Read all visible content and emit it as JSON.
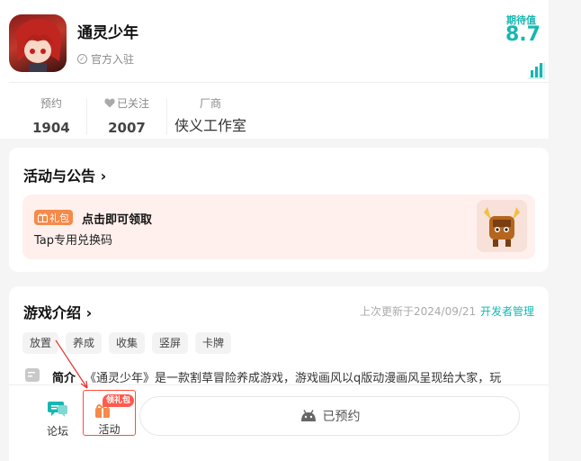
{
  "header": {
    "app_title": "通灵少年",
    "official_label": "官方入驻",
    "rating_label": "期待值",
    "rating_value": "8.7"
  },
  "stats": {
    "reservations_label": "预约",
    "reservations_value": "1904",
    "followed_label": "已关注",
    "followed_value": "2007",
    "developer_label": "厂商",
    "developer_name": "侠义工作室"
  },
  "activities": {
    "title": "活动与公告 ›",
    "gift_tag": "礼包",
    "gift_title": "点击即可领取",
    "gift_code": "Tap专用兑换码"
  },
  "intro": {
    "title": "游戏介绍 ›",
    "update_time": "上次更新于2024/09/21",
    "developer_manage": "开发者管理",
    "tags": [
      "放置",
      "养成",
      "收集",
      "竖屏",
      "卡牌"
    ],
    "summary_label": "简介",
    "summary_text": "《通灵少年》是一款割草冒险养成游戏，游戏画风以q版动漫画风呈现给大家，玩"
  },
  "bottom_bar": {
    "forum_label": "论坛",
    "activity_label": "活动",
    "gift_badge": "领礼包",
    "reserved_label": "已预约"
  },
  "colors": {
    "accent": "#17b7b0",
    "gift_orange": "#f58a4b",
    "badge_red": "#ff5b4d"
  }
}
